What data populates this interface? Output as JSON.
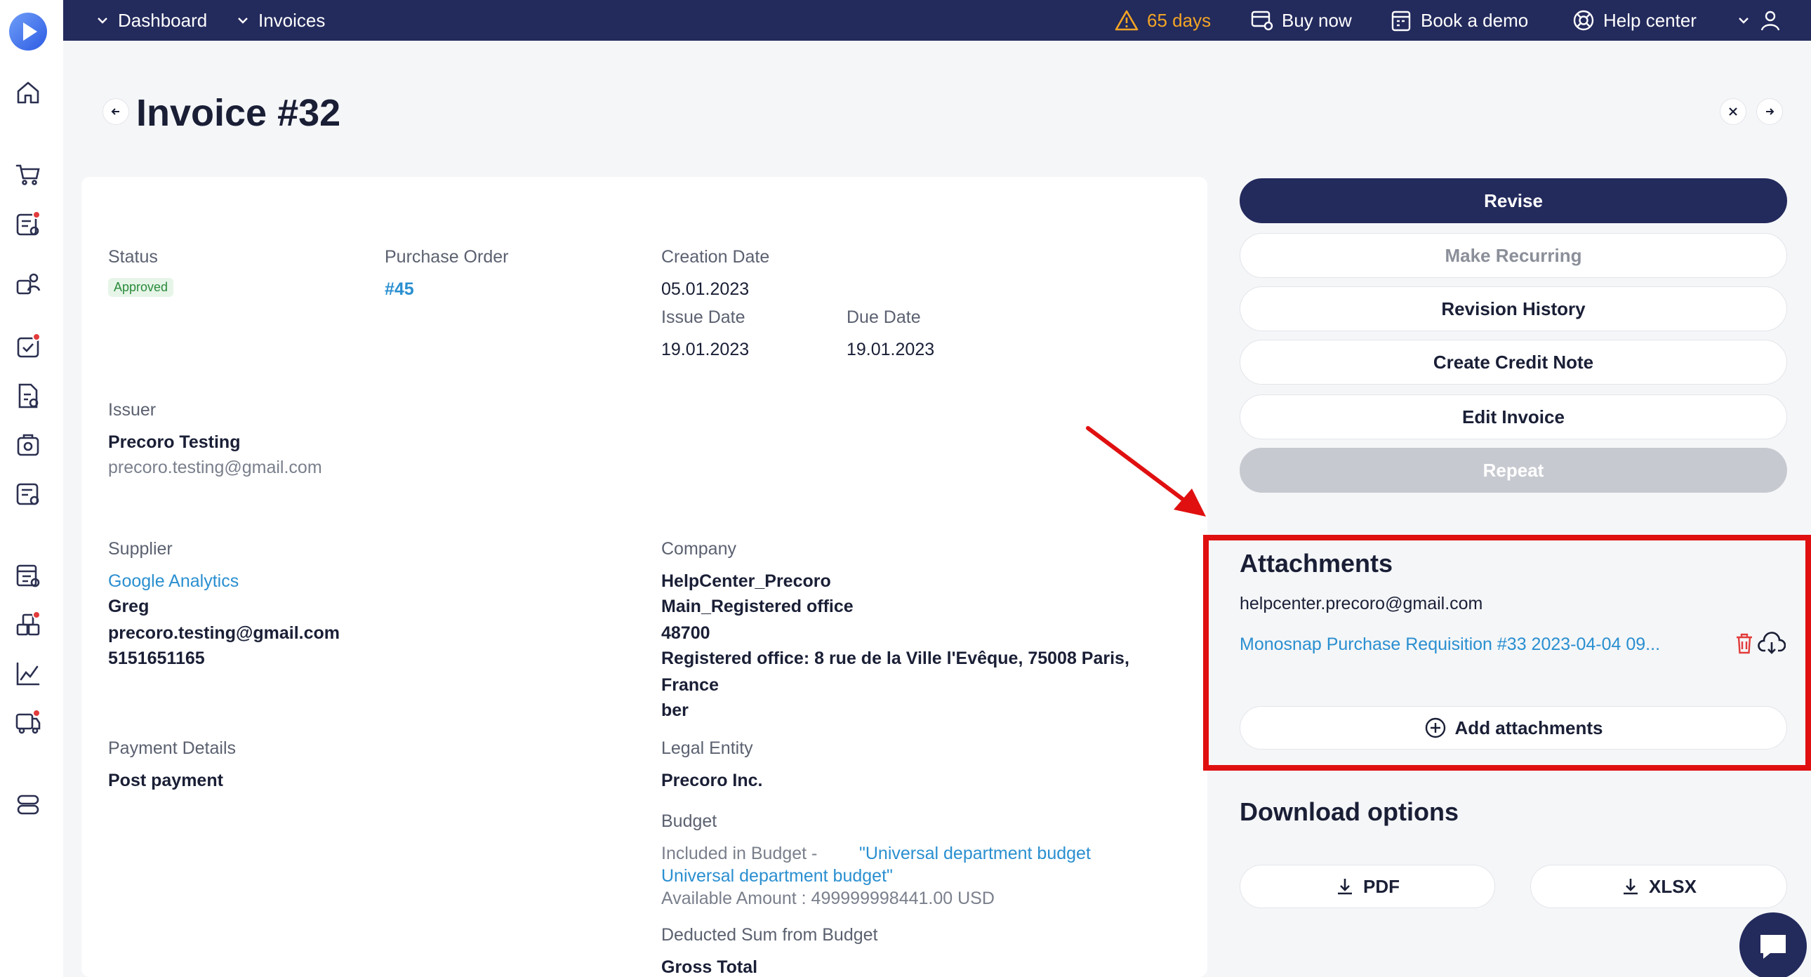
{
  "topbar": {
    "breadcrumb_dashboard": "Dashboard",
    "breadcrumb_invoices": "Invoices",
    "trial_days": "65 days",
    "buy_now": "Buy now",
    "book_demo": "Book a demo",
    "help_center": "Help center"
  },
  "page": {
    "title": "Invoice #32"
  },
  "details": {
    "status_label": "Status",
    "status_value": "Approved",
    "po_label": "Purchase Order",
    "po_value": "#45",
    "creation_label": "Creation Date",
    "creation_value": "05.01.2023",
    "issue_label": "Issue Date",
    "issue_value": "19.01.2023",
    "due_label": "Due Date",
    "due_value": "19.01.2023",
    "issuer_label": "Issuer",
    "issuer_name": "Precoro Testing",
    "issuer_email": "precoro.testing@gmail.com",
    "supplier_label": "Supplier",
    "supplier_name": "Google Analytics",
    "supplier_contact": "Greg",
    "supplier_email": "precoro.testing@gmail.com",
    "supplier_phone": "5151651165",
    "company_label": "Company",
    "company_lines": [
      "HelpCenter_Precoro",
      "Main_Registered office",
      "48700",
      "Registered office: 8 rue de la Ville l'Evêque, 75008 Paris,",
      "France",
      "ber"
    ],
    "payment_label": "Payment Details",
    "payment_value": "Post payment",
    "legal_label": "Legal Entity",
    "legal_value": "Precoro Inc.",
    "budget_label": "Budget",
    "budget_included_prefix": "Included in Budget - ",
    "budget_included_link_1": "\"Universal department budget",
    "budget_included_link_2": "Universal department budget\"",
    "budget_available": "Available Amount : 499999998441.00 USD",
    "deducted_label": "Deducted Sum from Budget",
    "gross_label": "Gross Total"
  },
  "actions": {
    "revise": "Revise",
    "make_recurring": "Make Recurring",
    "revision_history": "Revision History",
    "create_credit_note": "Create Credit Note",
    "edit_invoice": "Edit Invoice",
    "repeat": "Repeat"
  },
  "attachments": {
    "title": "Attachments",
    "email": "helpcenter.precoro@gmail.com",
    "file_name": "Monosnap Purchase Requisition #33 2023-04-04 09...",
    "add_label": "Add attachments"
  },
  "downloads": {
    "title": "Download options",
    "pdf": "PDF",
    "xlsx": "XLSX"
  },
  "colors": {
    "navy": "#232a5c",
    "link": "#2a8fd0",
    "highlight": "#e01010",
    "warning": "#f2a524",
    "approved": "#2a8a3a"
  }
}
